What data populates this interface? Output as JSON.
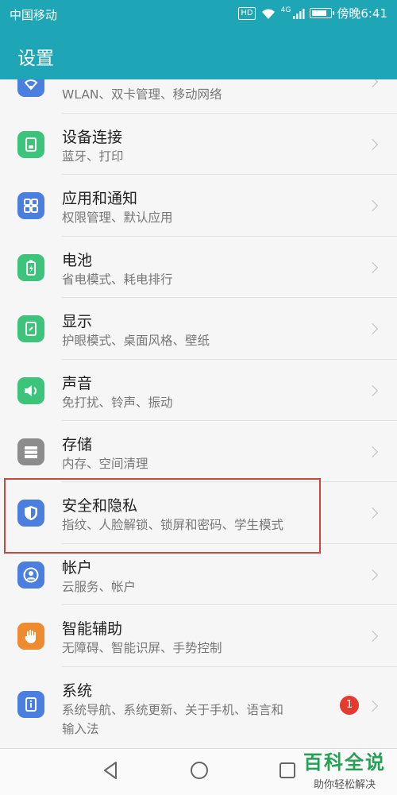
{
  "status_bar": {
    "carrier": "中国移动",
    "network_badge": "HD",
    "signal": "4G",
    "time": "傍晚6:41",
    "battery_level": 0.85
  },
  "header": {
    "title": "设置"
  },
  "rows": [
    {
      "title": "",
      "subtitle": "WLAN、双卡管理、移动网络",
      "icon": "wifi-icon",
      "color": "#4a7fe0"
    },
    {
      "title": "设备连接",
      "subtitle": "蓝牙、打印",
      "icon": "device-connect-icon",
      "color": "#3cc47a"
    },
    {
      "title": "应用和通知",
      "subtitle": "权限管理、默认应用",
      "icon": "apps-icon",
      "color": "#4a7fe0"
    },
    {
      "title": "电池",
      "subtitle": "省电模式、耗电排行",
      "icon": "battery-icon",
      "color": "#3cc47a"
    },
    {
      "title": "显示",
      "subtitle": "护眼模式、桌面风格、壁纸",
      "icon": "display-icon",
      "color": "#3cc47a"
    },
    {
      "title": "声音",
      "subtitle": "免打扰、铃声、振动",
      "icon": "sound-icon",
      "color": "#3cc47a"
    },
    {
      "title": "存储",
      "subtitle": "内存、空间清理",
      "icon": "storage-icon",
      "color": "#8c8c8c"
    },
    {
      "title": "安全和隐私",
      "subtitle": "指纹、人脸解锁、锁屏和密码、学生模式",
      "icon": "shield-icon",
      "color": "#4a7fe0"
    },
    {
      "title": "帐户",
      "subtitle": "云服务、帐户",
      "icon": "account-icon",
      "color": "#4a7fe0"
    },
    {
      "title": "智能辅助",
      "subtitle": "无障碍、智能识屏、手势控制",
      "icon": "hand-icon",
      "color": "#f08a2e"
    },
    {
      "title": "系统",
      "subtitle1": "系统导航、系统更新、关于手机、语言和",
      "subtitle2": "输入法",
      "icon": "system-info-icon",
      "color": "#4a7fe0",
      "badge": "1"
    }
  ],
  "watermark": {
    "line1": "百科全说",
    "line2": "助你轻松解决"
  }
}
